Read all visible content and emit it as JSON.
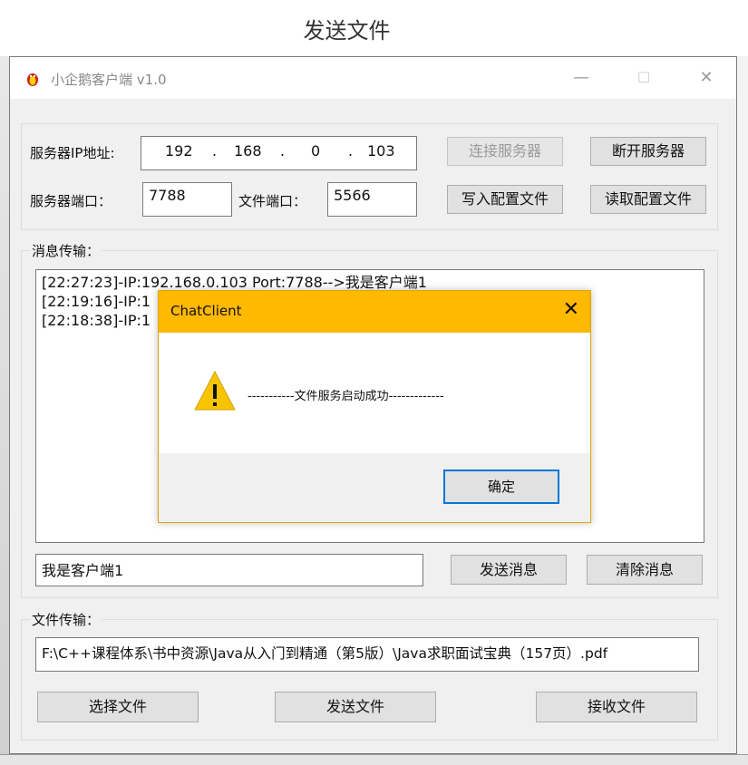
{
  "caption": "发送文件",
  "window": {
    "title": "小企鹅客户端 v1.0",
    "minimize": "—",
    "maximize": "☐",
    "close": "✕"
  },
  "server": {
    "ip_label": "服务器IP地址:",
    "ip": [
      "192",
      "168",
      "0",
      "103"
    ],
    "ip_dot": ".",
    "port_label": "服务器端口：",
    "port": "7788",
    "file_port_label": "文件端口：",
    "file_port": "5566",
    "connect_button": "连接服务器",
    "disconnect_button": "断开服务器",
    "write_config_button": "写入配置文件",
    "read_config_button": "读取配置文件"
  },
  "messages": {
    "group_label": "消息传输：",
    "log": [
      "[22:27:23]-IP:192.168.0.103 Port:7788-->我是客户端1",
      "[22:19:16]-IP:1",
      "[22:18:38]-IP:1"
    ],
    "input_value": "我是客户端1",
    "send_button": "发送消息",
    "clear_button": "清除消息"
  },
  "files": {
    "group_label": "文件传输：",
    "path": "F:\\C++课程体系\\书中资源\\Java从入门到精通（第5版）\\Java求职面试宝典（157页）.pdf",
    "select_button": "选择文件",
    "send_button": "发送文件",
    "receive_button": "接收文件"
  },
  "dialog": {
    "title": "ChatClient",
    "close": "✕",
    "message": "-----------文件服务启动成功-------------",
    "ok_button": "确定"
  },
  "colors": {
    "dialog_title_bg": "#ffb900",
    "ok_border": "#0078d7",
    "warning": "#f6c500"
  }
}
